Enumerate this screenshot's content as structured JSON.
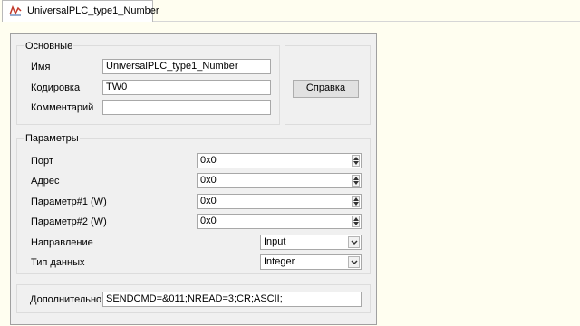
{
  "tab": {
    "label": "UniversalPLC_type1_Number",
    "icon": "plc-wave-icon"
  },
  "basic": {
    "legend": "Основные",
    "name_label": "Имя",
    "name_value": "UniversalPLC_type1_Number",
    "encoding_label": "Кодировка",
    "encoding_value": "TW0",
    "comment_label": "Комментарий",
    "comment_value": ""
  },
  "help_button": "Справка",
  "params": {
    "legend": "Параметры",
    "port_label": "Порт",
    "port_value": "0x0",
    "address_label": "Адрес",
    "address_value": "0x0",
    "param1_label": "Параметр#1 (W)",
    "param1_value": "0x0",
    "param2_label": "Параметр#2 (W)",
    "param2_value": "0x0",
    "direction_label": "Направление",
    "direction_value": "Input",
    "datatype_label": "Тип данных",
    "datatype_value": "Integer"
  },
  "extra": {
    "label": "Дополнительно",
    "value": "SENDCMD=&011;NREAD=3;CR;ASCII;"
  }
}
